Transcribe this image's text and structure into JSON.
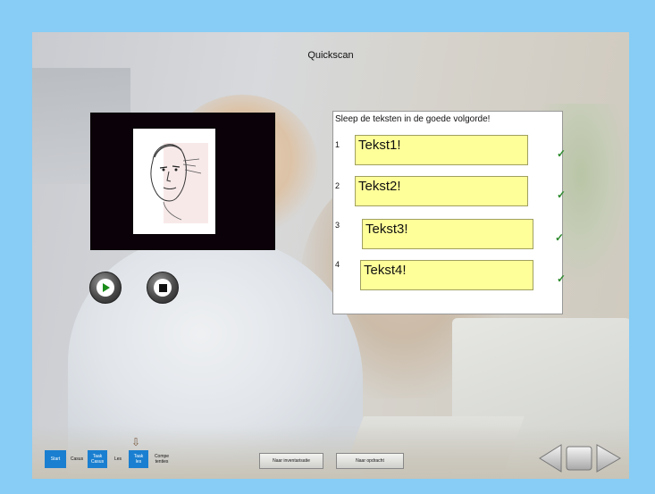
{
  "title": "Quickscan",
  "instruction": "Sleep de teksten in de goede volgorde!",
  "slots": [
    {
      "number": "1",
      "text": "Tekst1!",
      "check": "✓"
    },
    {
      "number": "2",
      "text": "Tekst2!",
      "check": "✓"
    },
    {
      "number": "3",
      "text": "Tekst3!",
      "check": "✓"
    },
    {
      "number": "4",
      "text": "Tekst4!",
      "check": "✓"
    }
  ],
  "nav_tabs": [
    {
      "label": "Start",
      "active": true
    },
    {
      "label": "Casus",
      "active": false
    },
    {
      "label": "Taak Casus",
      "active": true
    },
    {
      "label": "Les",
      "active": false
    },
    {
      "label": "Taak les",
      "active": true
    },
    {
      "label": "Compe tenties",
      "active": false
    }
  ],
  "buttons": {
    "to_inventory": "Naar inventarisatie",
    "to_assignment": "Naar opdracht"
  },
  "icons": {
    "play": "play-icon",
    "stop": "stop-icon",
    "back": "arrow-left-icon",
    "home": "square-icon",
    "forward": "arrow-right-icon",
    "check": "checkmark-icon"
  },
  "colors": {
    "frame": "#87CDF6",
    "text_box": "#FFFF99",
    "tab_active": "#1a7fd0",
    "check": "#2e8b2e",
    "video_bg": "#0a0208"
  }
}
